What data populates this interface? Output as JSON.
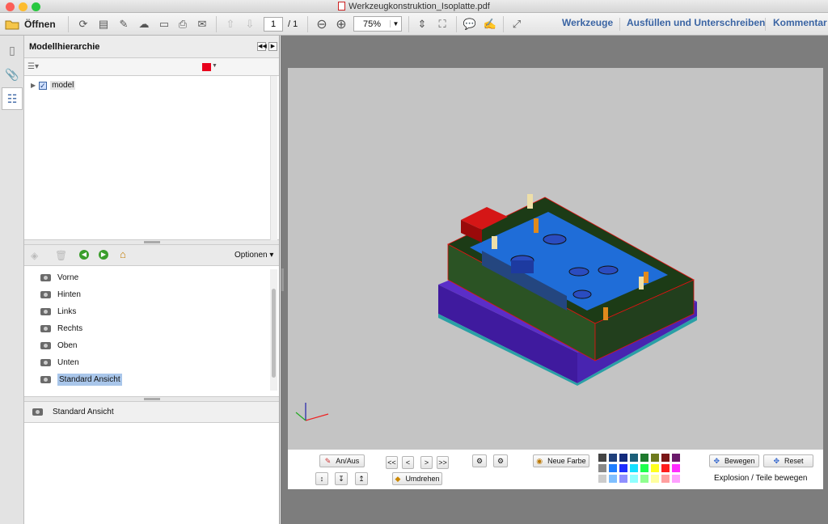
{
  "window": {
    "title": "Werkzeugkonstruktion_Isoplatte.pdf"
  },
  "toolbar": {
    "open_label": "Öffnen",
    "page_current": "1",
    "page_total": "/ 1",
    "zoom": "75%",
    "tabs": [
      "Werkzeuge",
      "Ausfüllen und Unterschreiben",
      "Kommentar"
    ]
  },
  "panel": {
    "title": "Modellhierarchie",
    "tree_item": "model",
    "views_options": "Optionen",
    "views": [
      "Vorne",
      "Hinten",
      "Links",
      "Rechts",
      "Oben",
      "Unten",
      "Standard Ansicht"
    ],
    "selected_view": "Standard Ansicht",
    "bottom_label": "Standard Ansicht",
    "color_swatch": "#e8001c"
  },
  "controls": {
    "on_off": "An/Aus",
    "prev_all": "<<",
    "prev": "<",
    "next": ">",
    "next_all": ">>",
    "new_color": "Neue Farbe",
    "flip": "Umdrehen",
    "move": "Bewegen",
    "reset": "Reset",
    "explosion": "Explosion / Teile bewegen"
  },
  "colors": {
    "accent": "#3a64a3",
    "palette_row1": [
      "#444444",
      "#1f3f7a",
      "#122a7c",
      "#1b5f7a",
      "#1e7a2d",
      "#6e7a1d",
      "#7a1616",
      "#6b1a6b"
    ],
    "palette_row2": [
      "#888888",
      "#1e7eff",
      "#1e2dff",
      "#14e0ff",
      "#1eff4d",
      "#ffff1e",
      "#ff1e1e",
      "#ff2dff"
    ],
    "palette_row3": [
      "#cccccc",
      "#7fbfff",
      "#8f8fff",
      "#8fffff",
      "#8fff8f",
      "#ffff9f",
      "#ff9f9f",
      "#ff9fff"
    ]
  }
}
